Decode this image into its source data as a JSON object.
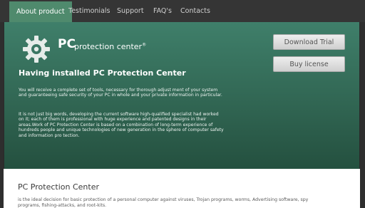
{
  "nav": {
    "tabs": [
      {
        "label": "About product",
        "active": true
      },
      {
        "label": "Testimonials",
        "active": false
      },
      {
        "label": "Support",
        "active": false
      },
      {
        "label": "FAQ's",
        "active": false
      },
      {
        "label": "Contacts",
        "active": false
      }
    ]
  },
  "hero": {
    "logo_main": "PC",
    "logo_sub": "protection center",
    "logo_trademark": "®",
    "title": "Having installed PC Protection Center",
    "paragraph1": "You will receive a complete set of tools, necessary for thorough adjust ment of your system and guaranteeing safe security of your PC in whole and your private information in particular.",
    "paragraph2": "It is not just big words, developing the current software high-qualified specialist had worked on it; each of them is professional with huge experience and patented designs in their areas.Work of PC Protection Center is based on a combination of long-term experience of hundreds people and unique technologies of new generation in the sphere of computer safety and information pro tection."
  },
  "actions": {
    "download_label": "Download Trial",
    "buy_label": "Buy license"
  },
  "content": {
    "title": "PC Protection Center",
    "text": "is the ideal decision for basic protection of a personal computer against viruses, Trojan programs, worms, Advertising software, spy programs, fishing-attacks, and root-kits."
  },
  "colors": {
    "accent": "#4f8a6d",
    "hero_top": "#3f7f6a",
    "hero_bottom": "#24503f",
    "nav_bg": "#353535"
  },
  "icons": {
    "logo": "gear-icon"
  }
}
